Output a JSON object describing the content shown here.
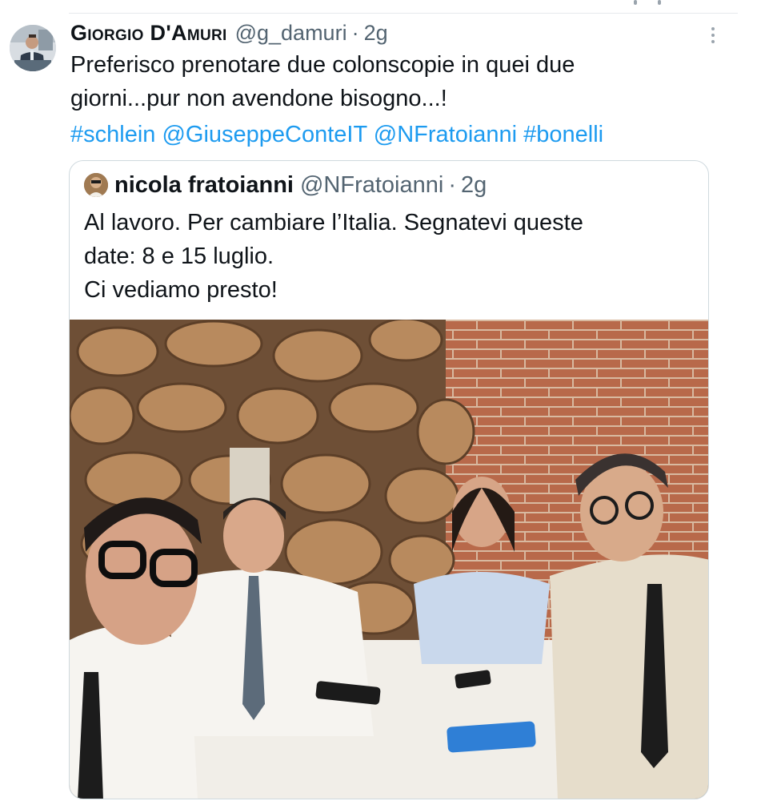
{
  "tweet": {
    "author": {
      "display_name": "Giorgio D'Amuri",
      "handle": "@g_damuri",
      "separator": "·",
      "time": "2g",
      "avatar": "user-avatar"
    },
    "text_lines": [
      "Preferisco prenotare due colonscopie in quei due",
      "giorni...pur non avendone bisogno...!"
    ],
    "tags": [
      "#schlein",
      "@GiuseppeConteIT",
      "@NFratoianni",
      "#bonelli"
    ],
    "more_icon": "more-vertical-icon"
  },
  "quoted_tweet": {
    "author": {
      "display_name": "nicola fratoianni",
      "handle": "@NFratoianni",
      "separator": "·",
      "time": "2g"
    },
    "text_lines": [
      "Al lavoro. Per cambiare l’Italia. Segnatevi queste",
      "date: 8 e 15 luglio.",
      "Ci vediamo presto!"
    ],
    "media": "photo"
  },
  "colors": {
    "link": "#1d9bf0",
    "secondary_text": "#536471",
    "primary_text": "#0f1419",
    "border": "#cfd9de"
  }
}
